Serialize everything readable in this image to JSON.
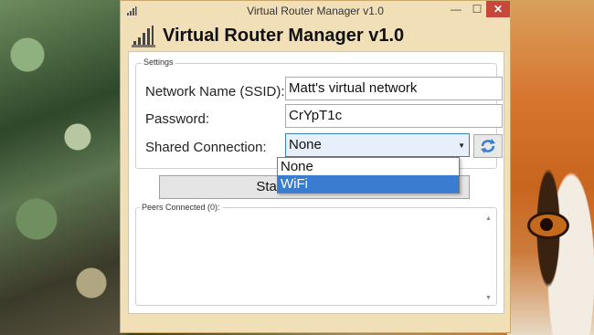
{
  "window": {
    "title": "Virtual Router Manager v1.0",
    "minimize_glyph": "—",
    "maximize_glyph": "☐",
    "close_glyph": "✕",
    "header_title": "Virtual Router Manager v1.0",
    "icon": "router-signal-icon"
  },
  "settings": {
    "group_label": "Settings",
    "ssid_label": "Network Name (SSID):",
    "ssid_value": "Matt's virtual network",
    "password_label": "Password:",
    "password_value": "CrYpT1c",
    "shared_label": "Shared Connection:",
    "shared_value": "None",
    "refresh_icon": "refresh-arrows-icon"
  },
  "start_button_label": "Start Virtual Router",
  "peers": {
    "label": "Peers Connected (0):"
  },
  "dropdown": {
    "options": [
      "None",
      "WiFi"
    ],
    "highlighted": "WiFi"
  },
  "colors": {
    "window_bg": "#f1dfb8",
    "combo_border": "#3c7fb1",
    "highlight": "#3a7cd0",
    "close_button": "#c7473a"
  }
}
